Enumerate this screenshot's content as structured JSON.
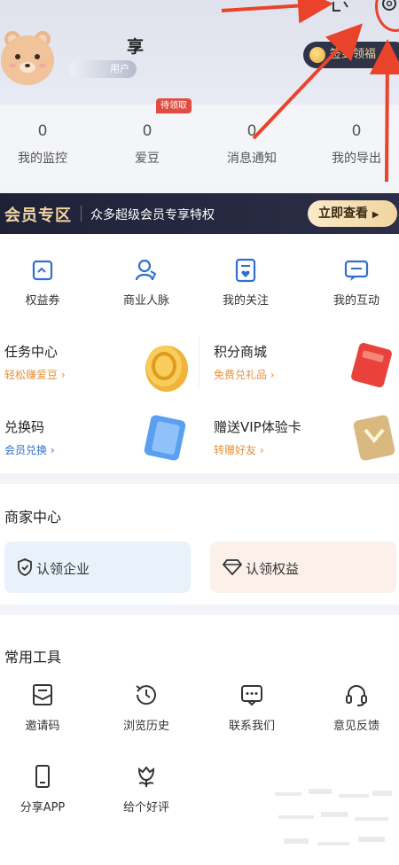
{
  "header": {
    "username": "享",
    "user_tag": "用户",
    "checkin_label": "签到领福"
  },
  "stats": [
    {
      "value": "0",
      "label": "我的监控"
    },
    {
      "value": "0",
      "label": "爱豆"
    },
    {
      "value": "0",
      "label": "消息通知"
    },
    {
      "value": "0",
      "label": "我的导出"
    }
  ],
  "pending_badge": "待领取",
  "vip": {
    "title": "会员专区",
    "desc": "众多超级会员专享特权",
    "button": "立即查看"
  },
  "quick_actions": [
    {
      "label": "权益券",
      "icon": "coupon-icon"
    },
    {
      "label": "商业人脉",
      "icon": "contacts-icon"
    },
    {
      "label": "我的关注",
      "icon": "follow-icon"
    },
    {
      "label": "我的互动",
      "icon": "chat-icon"
    }
  ],
  "promos": [
    {
      "title": "任务中心",
      "sub": "轻松赚爱豆",
      "icon": "coin-icon"
    },
    {
      "title": "积分商城",
      "sub": "免费兑礼品",
      "icon": "gift-icon"
    },
    {
      "title": "兑换码",
      "sub": "会员兑换",
      "icon": "card-icon"
    },
    {
      "title": "赠送VIP体验卡",
      "sub": "转赠好友",
      "icon": "vip-card-icon"
    }
  ],
  "merchant": {
    "title": "商家中心",
    "claim_company": "认领企业",
    "claim_rights": "认领权益"
  },
  "tools": {
    "title": "常用工具",
    "items": [
      {
        "label": "邀请码",
        "icon": "invite-icon"
      },
      {
        "label": "浏览历史",
        "icon": "history-icon"
      },
      {
        "label": "联系我们",
        "icon": "message-icon"
      },
      {
        "label": "意见反馈",
        "icon": "headset-icon"
      },
      {
        "label": "分享APP",
        "icon": "phone-icon"
      },
      {
        "label": "给个好评",
        "icon": "flower-icon"
      }
    ]
  },
  "colors": {
    "accent_gold": "#f2d6a2",
    "vip_dark": "#1f2237",
    "annotation_red": "#e9432c",
    "icon_blue": "#2f6fd0",
    "promo_orange": "#e8913a"
  }
}
